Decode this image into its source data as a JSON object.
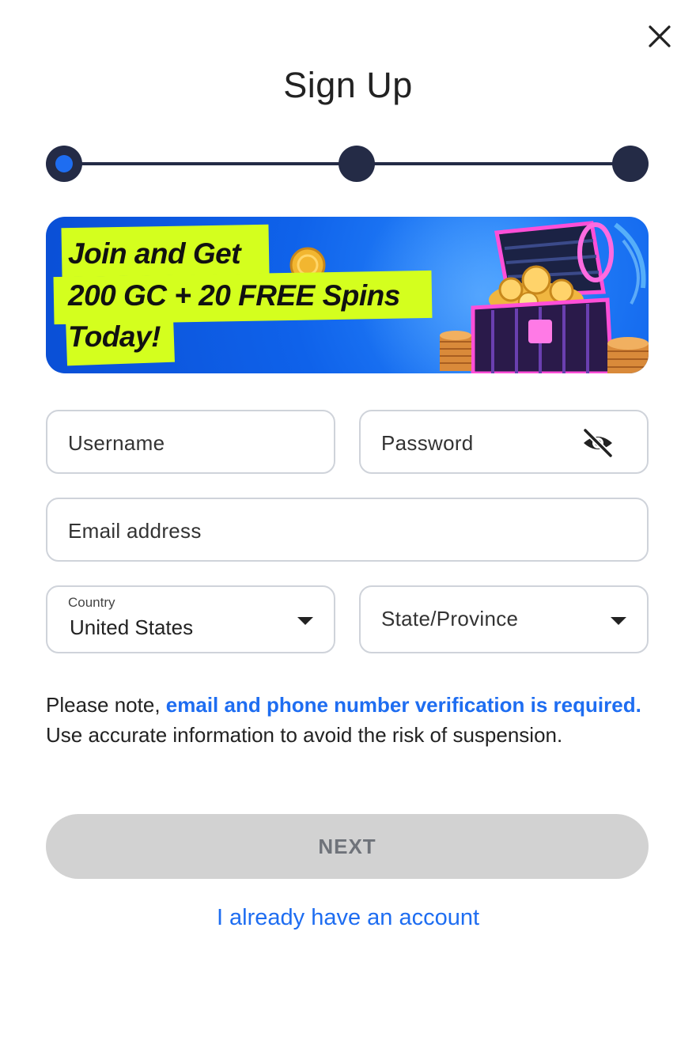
{
  "dialog": {
    "title": "Sign Up",
    "close_icon": "close-icon"
  },
  "stepper": {
    "current_step": 1,
    "total_steps": 3,
    "colors": {
      "active": "#1e6df1",
      "inactive": "#242b46"
    }
  },
  "banner": {
    "line1": "Join and Get",
    "line2": "200 GC + 20 FREE Spins",
    "line3": "Today!",
    "highlight_color": "#d4ff1e",
    "background_color": "#0f62ea"
  },
  "form": {
    "username_placeholder": "Username",
    "password_placeholder": "Password",
    "password_toggle_icon": "eye-off-icon",
    "email_placeholder": "Email address",
    "country_label": "Country",
    "country_value": "United States",
    "state_placeholder": "State/Province"
  },
  "note": {
    "prefix": "Please note, ",
    "emphasis": "email and phone number verification is required.",
    "suffix": " Use accurate information to avoid the risk of suspension."
  },
  "actions": {
    "next_label": "NEXT",
    "login_link": "I already have an account"
  },
  "colors": {
    "accent": "#1e6df1",
    "disabled_button": "#d2d2d2"
  }
}
